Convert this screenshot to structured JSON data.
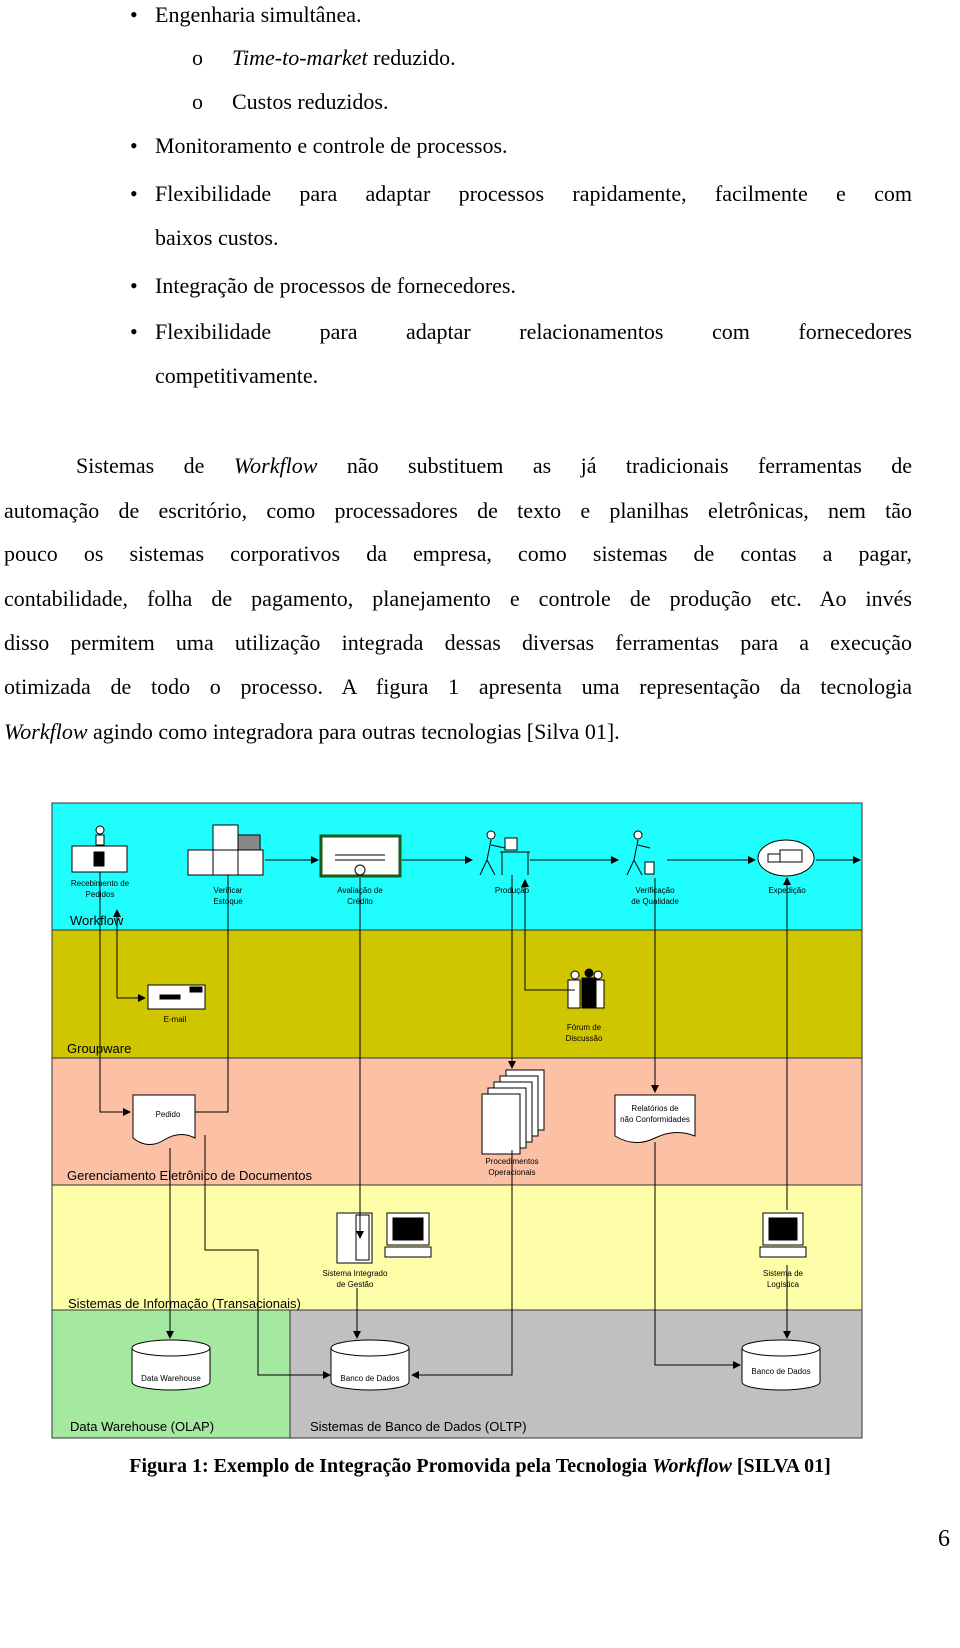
{
  "bullets": {
    "b1": "Engenharia simultânea.",
    "b1a_italic": "Time-to-market",
    "b1a_rest": " reduzido.",
    "b1b": "Custos reduzidos.",
    "b2": "Monitoramento e controle de processos.",
    "b3_line1": "Flexibilidade para adaptar processos rapidamente, facilmente e com",
    "b3_line2": "baixos custos.",
    "b4": "Integração de processos de fornecedores.",
    "b5_line1": "Flexibilidade para adaptar relacionamentos com fornecedores",
    "b5_line2": "competitivamente.",
    "sub_marker": "o",
    "bullet_marker": "•"
  },
  "paragraph": {
    "l1_a": "Sistemas de ",
    "l1_i": "Workflow",
    "l1_b": " não substituem as já tradicionais ferramentas de",
    "l2": "automação de escritório, como processadores de texto e planilhas eletrônicas, nem tão",
    "l3": "pouco os sistemas corporativos da empresa, como sistemas de contas a pagar,",
    "l4": "contabilidade, folha de pagamento, planejamento e controle de produção etc. Ao invés",
    "l5": "disso permitem uma utilização integrada dessas diversas ferramentas para a execução",
    "l6": "otimizada de todo o processo. A figura 1 apresenta uma representação da tecnologia",
    "l7_i": "Workflow",
    "l7_b": " agindo como integradora para outras tecnologias [Silva 01]."
  },
  "diagram": {
    "bands": {
      "workflow": "Workflow",
      "groupware": "Groupware",
      "ged": "Gerenciamento Eletrônico de Documentos",
      "si": "Sistemas de Informação (Transacionais)",
      "dw": "Data Warehouse (OLAP)",
      "sbd": "Sistemas de Banco de Dados (OLTP)"
    },
    "colors": {
      "workflow": "#1ffdfd",
      "groupware": "#cfc600",
      "ged": "#fcc0a4",
      "si": "#fefda8",
      "dw": "#a5e9a0",
      "sbd": "#c0c0c0"
    },
    "nodes": {
      "recebimento": [
        "Recebimento de",
        "Pedidos"
      ],
      "verificar": [
        "Verificar",
        "Estoque"
      ],
      "avaliacao": [
        "Avaliação de",
        "Crédito"
      ],
      "producao": [
        "Produção"
      ],
      "verificacao": [
        "Verificação",
        "de Qualidade"
      ],
      "expedicao": [
        "Expedição"
      ],
      "email": [
        "E-mail"
      ],
      "forum": [
        "Fórum de",
        "Discussão"
      ],
      "pedido": [
        "Pedido"
      ],
      "procedimentos": [
        "Procedimentos",
        "Operacionais"
      ],
      "relatorios": [
        "Relatórios de",
        "não Conformidades"
      ],
      "sig": [
        "Sistema Integrado",
        "de Gestão"
      ],
      "logistica": [
        "Sistema de",
        "Logística"
      ],
      "dw": [
        "Data Warehouse"
      ],
      "bd1": [
        "Banco de Dados"
      ],
      "bd2": [
        "Banco de Dados"
      ]
    }
  },
  "caption": {
    "a": "Figura 1: Exemplo de Integração Promovida pela Tecnologia ",
    "i": "Workflow",
    "b": " [SILVA 01]"
  },
  "page_number": "6"
}
